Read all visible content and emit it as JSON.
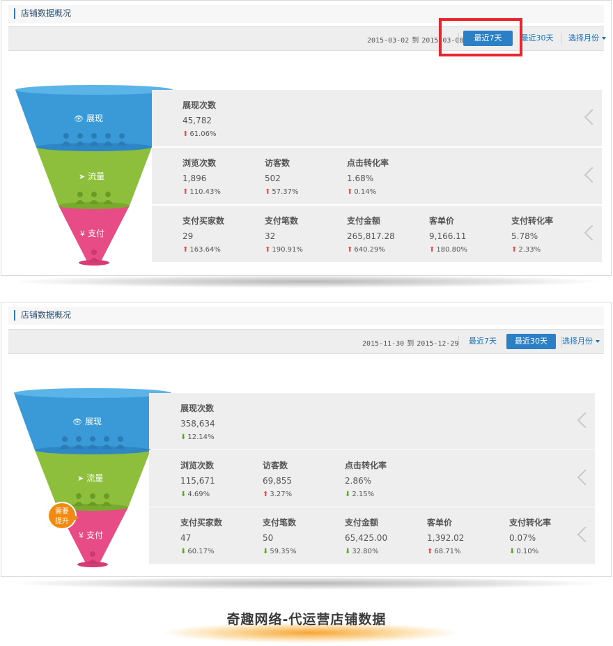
{
  "footer": "奇趣网络-代运营店铺数据",
  "colors": {
    "stage1": "#3a9ad8",
    "stage2": "#8dbf3c",
    "stage3": "#e74c86",
    "highlight": "#e8262d",
    "accent": "#2a7fc5",
    "badge": "#f08a10",
    "up": "#e05252",
    "down": "#5aa12c"
  },
  "panel1": {
    "title": "店铺数据概况",
    "date_start": "2015-03-02",
    "date_sep": "到",
    "date_end": "2015-03-08",
    "btn_7": "最近7天",
    "btn_30": "最近30天",
    "month": "选择月份",
    "active": "7",
    "stages": [
      {
        "label": "展现",
        "icon": "eye-icon"
      },
      {
        "label": "流量",
        "icon": "cursor-icon"
      },
      {
        "label": "支付",
        "icon": "yen-icon"
      }
    ],
    "rows": [
      [
        {
          "label": "展现次数",
          "value": "45,782",
          "change": "61.06%",
          "dir": "up"
        }
      ],
      [
        {
          "label": "浏览次数",
          "value": "1,896",
          "change": "110.43%",
          "dir": "up"
        },
        {
          "label": "访客数",
          "value": "502",
          "change": "57.37%",
          "dir": "up"
        },
        {
          "label": "点击转化率",
          "value": "1.68%",
          "change": "0.14%",
          "dir": "up"
        }
      ],
      [
        {
          "label": "支付买家数",
          "value": "29",
          "change": "163.64%",
          "dir": "up"
        },
        {
          "label": "支付笔数",
          "value": "32",
          "change": "190.91%",
          "dir": "up"
        },
        {
          "label": "支付金额",
          "value": "265,817.28",
          "change": "640.29%",
          "dir": "up"
        },
        {
          "label": "客单价",
          "value": "9,166.11",
          "change": "180.80%",
          "dir": "up"
        },
        {
          "label": "支付转化率",
          "value": "5.78%",
          "change": "2.33%",
          "dir": "up"
        }
      ]
    ]
  },
  "panel2": {
    "title": "店铺数据概况",
    "date_start": "2015-11-30",
    "date_sep": "到",
    "date_end": "2015-12-29",
    "btn_7": "最近7天",
    "btn_30": "最近30天",
    "month": "选择月份",
    "active": "30",
    "badge_line1": "需要",
    "badge_line2": "提升",
    "stages": [
      {
        "label": "展现",
        "icon": "eye-icon"
      },
      {
        "label": "流量",
        "icon": "cursor-icon"
      },
      {
        "label": "支付",
        "icon": "yen-icon"
      }
    ],
    "rows": [
      [
        {
          "label": "展现次数",
          "value": "358,634",
          "change": "12.14%",
          "dir": "down"
        }
      ],
      [
        {
          "label": "浏览次数",
          "value": "115,671",
          "change": "4.69%",
          "dir": "down"
        },
        {
          "label": "访客数",
          "value": "69,855",
          "change": "3.27%",
          "dir": "up"
        },
        {
          "label": "点击转化率",
          "value": "2.86%",
          "change": "2.15%",
          "dir": "down"
        }
      ],
      [
        {
          "label": "支付买家数",
          "value": "47",
          "change": "60.17%",
          "dir": "down"
        },
        {
          "label": "支付笔数",
          "value": "50",
          "change": "59.35%",
          "dir": "down"
        },
        {
          "label": "支付金额",
          "value": "65,425.00",
          "change": "32.80%",
          "dir": "down"
        },
        {
          "label": "客单价",
          "value": "1,392.02",
          "change": "68.71%",
          "dir": "up"
        },
        {
          "label": "支付转化率",
          "value": "0.07%",
          "change": "0.10%",
          "dir": "down"
        }
      ]
    ]
  }
}
